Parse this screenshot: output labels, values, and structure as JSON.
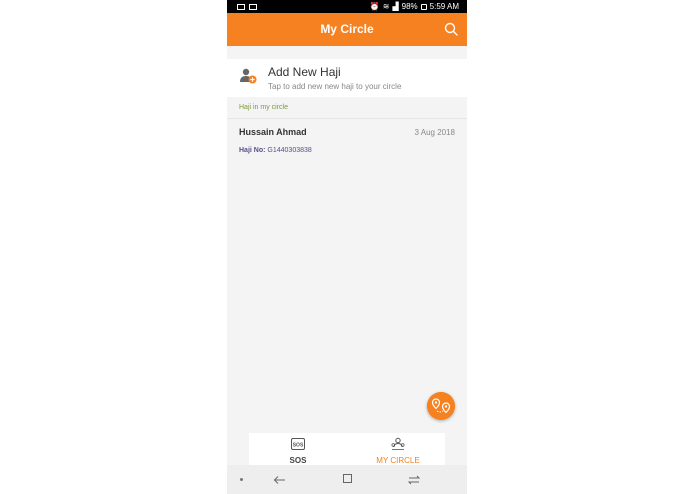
{
  "status_bar": {
    "battery": "98%",
    "time": "5:59 AM"
  },
  "app_bar": {
    "title": "My Circle"
  },
  "add_card": {
    "title": "Add New Haji",
    "subtitle": "Tap to add new new haji to your circle"
  },
  "section": {
    "label": "Haji in my circle"
  },
  "rows": [
    {
      "name": "Hussain Ahmad",
      "date": "3 Aug 2018",
      "haji_label": "Haji No:",
      "haji_no": "G1440303838"
    }
  ],
  "bottom_nav": {
    "sos_label": "SOS",
    "circle_label": "MY CIRCLE",
    "sos_icon_text": "SOS"
  },
  "colors": {
    "accent": "#f68120",
    "section_label": "#7a9a3a",
    "haji_no": "#5a4e8a"
  }
}
